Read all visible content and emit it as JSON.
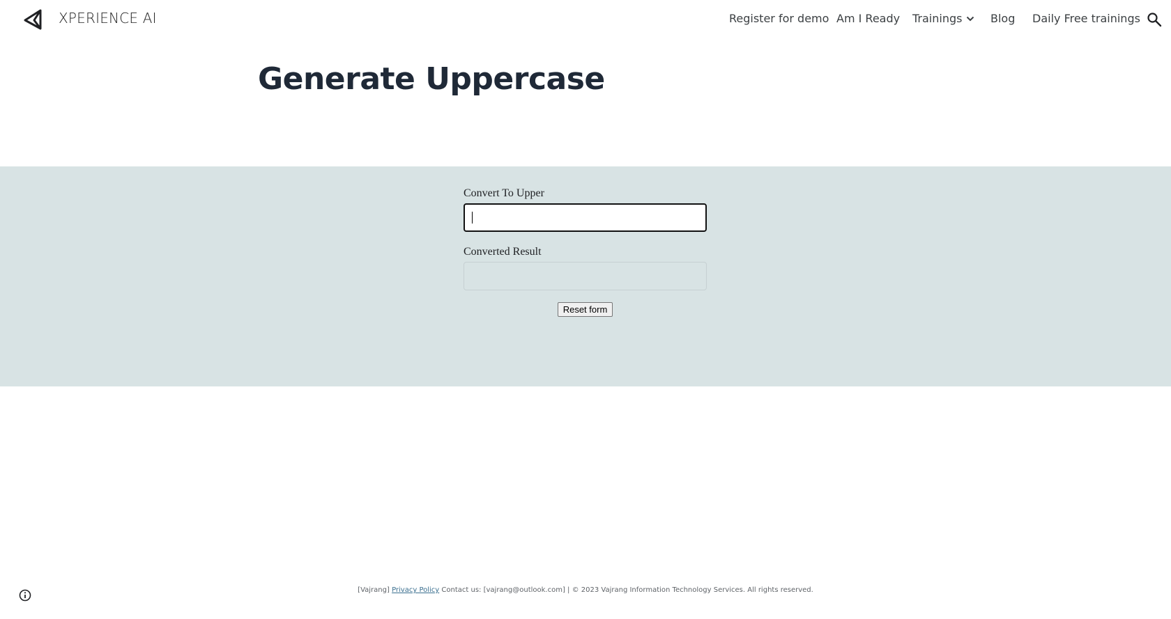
{
  "header": {
    "site_name": "XPERIENCE AI",
    "nav": [
      {
        "label": "Register for demo"
      },
      {
        "label": "Am I Ready"
      },
      {
        "label": "Trainings",
        "has_dropdown": true
      },
      {
        "label": "Blog"
      },
      {
        "label": "Daily Free trainings"
      }
    ],
    "search_icon": "search-icon",
    "logo_icon": "back-triangle-logo-icon"
  },
  "main": {
    "title": "Generate Uppercase"
  },
  "form": {
    "upper_label": "Convert To Upper",
    "upper_value": "",
    "result_label": "Converted Result",
    "result_value": "",
    "reset_label": "Reset form"
  },
  "footer": {
    "prefix": "[Vajrang]",
    "privacy_link": "Privacy Policy",
    "contact": "Contact us: [vajrang@outlook.com] | © 2023 Vajrang Information Technology Services. All rights reserved.",
    "info_icon": "info-icon"
  },
  "colors": {
    "band_bg": "#d8e3e4",
    "title": "#1f2937",
    "link": "#3a6f8f"
  }
}
